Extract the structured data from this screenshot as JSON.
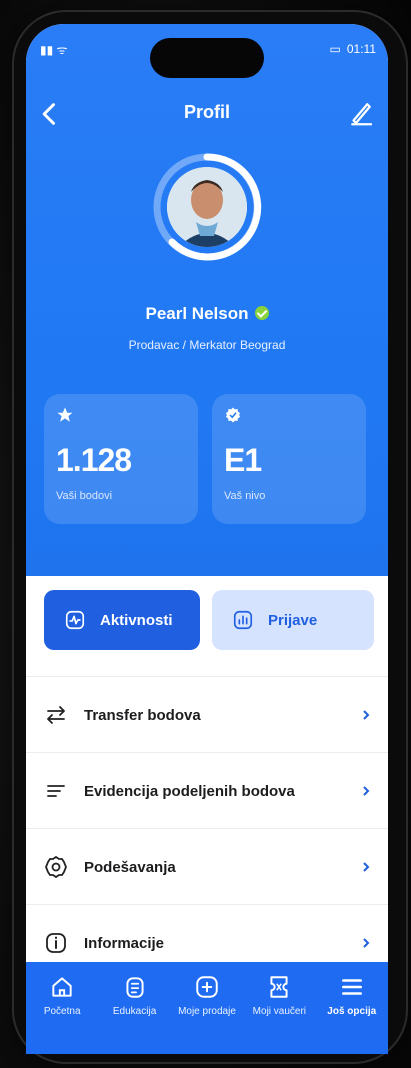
{
  "status": {
    "time": "01:11"
  },
  "header": {
    "title": "Profil"
  },
  "profile": {
    "name": "Pearl Nelson",
    "role": "Prodavac / Merkator Beograd"
  },
  "stats": [
    {
      "value": "1.128",
      "label": "Vaši bodovi",
      "icon": "star-icon"
    },
    {
      "value": "E1",
      "label": "Vaš nivo",
      "icon": "badge-icon"
    }
  ],
  "segments": {
    "active": "Aktivnosti",
    "other": "Prijave"
  },
  "menu": [
    {
      "label": "Transfer bodova",
      "icon": "transfer-icon"
    },
    {
      "label": "Evidencija podeljenih bodova",
      "icon": "list-icon"
    },
    {
      "label": "Podešavanja",
      "icon": "settings-icon"
    },
    {
      "label": "Informacije",
      "icon": "info-icon"
    }
  ],
  "bottom_nav": [
    {
      "label": "Početna",
      "icon": "home-icon"
    },
    {
      "label": "Edukacija",
      "icon": "clipboard-icon"
    },
    {
      "label": "Moje prodaje",
      "icon": "plus-box-icon"
    },
    {
      "label": "Moji vaučeri",
      "icon": "voucher-icon"
    },
    {
      "label": "Još opcija",
      "icon": "menu-icon"
    }
  ],
  "colors": {
    "primary": "#2079f3",
    "primary_dark": "#1f5fe0",
    "accent_light": "#d6e3ff"
  }
}
